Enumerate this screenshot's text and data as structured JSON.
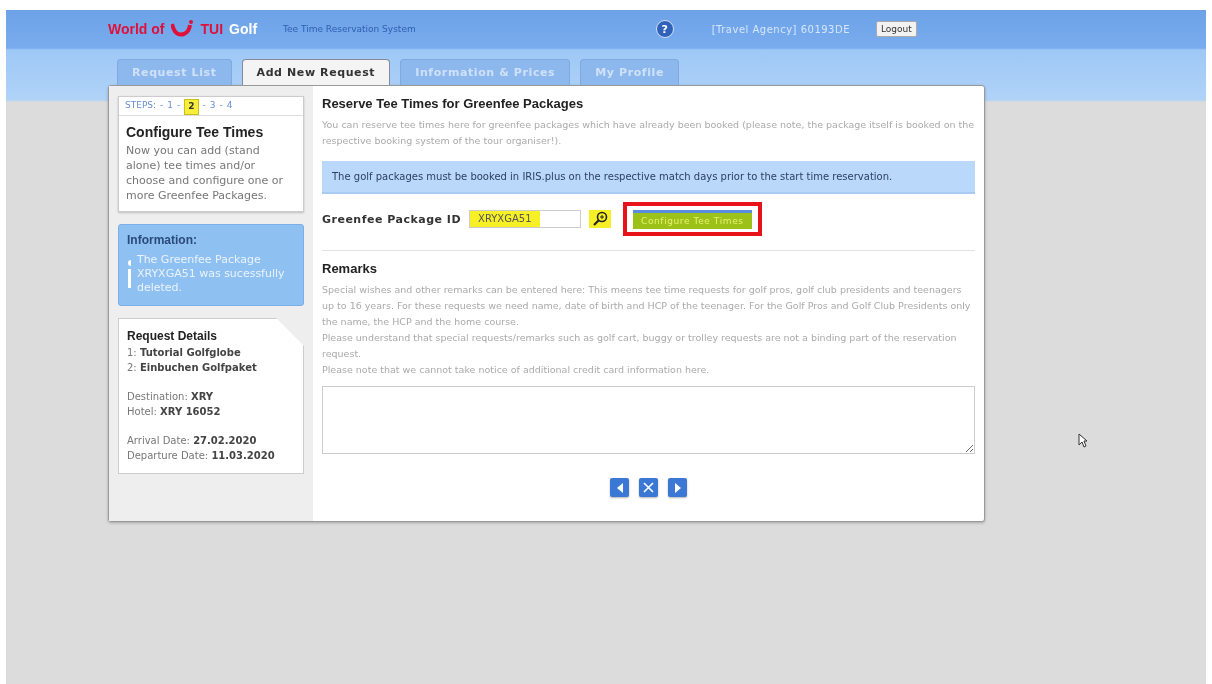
{
  "header": {
    "logo": {
      "part1": "World of",
      "part2": "TUI",
      "part3": "Golf"
    },
    "subtitle": "Tee Time Reservation System",
    "help": "?",
    "user": "[Travel Agency] 60193DE",
    "logout": "Logout"
  },
  "tabs": [
    {
      "label": "Request List",
      "selected": false
    },
    {
      "label": "Add New Request",
      "selected": true
    },
    {
      "label": "Information & Prices",
      "selected": false
    },
    {
      "label": "My Profile",
      "selected": false
    }
  ],
  "steps": {
    "label": "STEPS:",
    "separator": "-",
    "items": [
      {
        "label": "1",
        "selected": false
      },
      {
        "label": "2",
        "selected": true
      },
      {
        "label": "3",
        "selected": false
      },
      {
        "label": "4",
        "selected": false
      }
    ]
  },
  "step_card": {
    "title": "Configure Tee Times",
    "text": "Now you can add (stand alone) tee times and/or choose and configure one or more Greenfee Packages."
  },
  "info_box": {
    "title": "Information:",
    "text": "The Greenfee Package XRYXGA51 was sucessfully deleted."
  },
  "request_details": {
    "title": "Request Details",
    "groups": [
      [
        {
          "label": "1:",
          "value": "Tutorial Golfglobe"
        },
        {
          "label": "2:",
          "value": "Einbuchen Golfpaket"
        }
      ],
      [
        {
          "label": "Destination:",
          "value": "XRY"
        },
        {
          "label": "Hotel:",
          "value": "XRY 16052"
        }
      ],
      [
        {
          "label": "Arrival Date:",
          "value": "27.02.2020"
        },
        {
          "label": "Departure Date:",
          "value": "11.03.2020"
        }
      ]
    ]
  },
  "main": {
    "title": "Reserve Tee Times for Greenfee Packages",
    "intro": "You can reserve tee times here for greenfee packages which have already been booked (please note, the package itself is booked on the respective booking system of the tour organiser!).",
    "notice": "The golf packages must be booked in IRIS.plus on the respective match days prior to the start time reservation.",
    "package_field": {
      "label": "Greenfee Package ID",
      "value": "XRYXGA51",
      "highlighted": true
    },
    "configure_button": {
      "label": "Configure Tee Times",
      "highlighted": true,
      "outlined": true
    }
  },
  "remarks": {
    "title": "Remarks",
    "paragraphs": [
      "Special wishes and other remarks can be entered here: This meens tee time requests for golf pros, golf club presidents and teenagers up to 16 years. For these requests we need name, date of birth and HCP of the teenager. For the Golf Pros and Golf Club Presidents only the name, the HCP and the home course.",
      "Please understand that special requests/remarks such as golf cart, buggy or trolley requests are not a binding part of the reservation request.",
      "Please note that we cannot take notice of additional credit card information here."
    ]
  },
  "nav_buttons": [
    {
      "kind": "back"
    },
    {
      "kind": "cancel"
    },
    {
      "kind": "next"
    }
  ]
}
